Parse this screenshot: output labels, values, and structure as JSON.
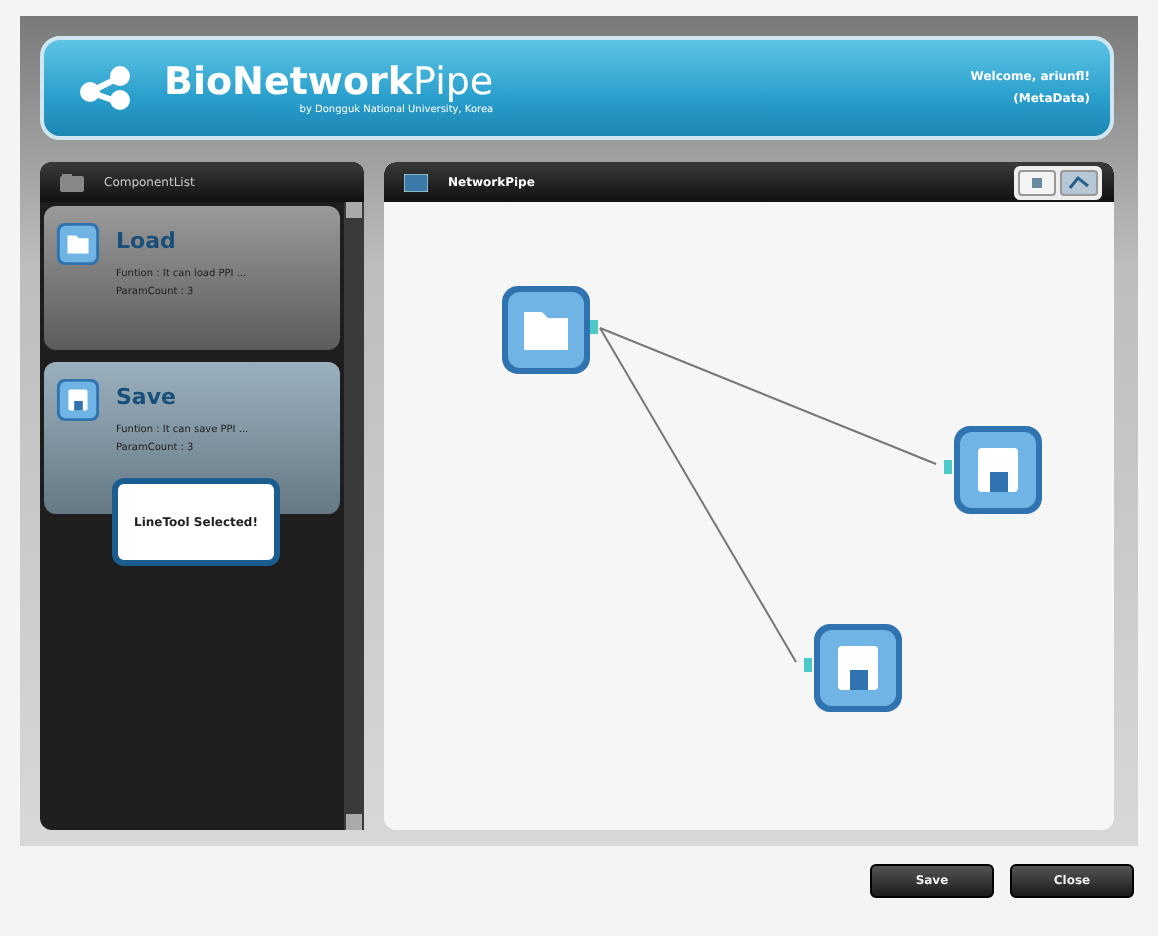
{
  "header": {
    "title": "BioNetwork",
    "title_suffix": "Pipe",
    "subtitle": "by Dongguk National University, Korea",
    "welcome": "Welcome, ariunfl!",
    "link": "(MetaData)"
  },
  "component_list": {
    "title": "ComponentList",
    "items": [
      {
        "kind": "load",
        "name": "Load",
        "function": "Funtion : It can load PPI ...",
        "params": "ParamCount : 3",
        "selected": false
      },
      {
        "kind": "save",
        "name": "Save",
        "function": "Funtion : It can save PPI ...",
        "params": "ParamCount : 3",
        "selected": true
      }
    ]
  },
  "toast": "LineTool Selected!",
  "canvas": {
    "title": "NetworkPipe",
    "tools": [
      {
        "kind": "select",
        "selected": false
      },
      {
        "kind": "line",
        "selected": true
      }
    ],
    "nodes": [
      {
        "kind": "load"
      },
      {
        "kind": "save"
      },
      {
        "kind": "save"
      }
    ]
  },
  "buttons": [
    "Save",
    "Close"
  ]
}
